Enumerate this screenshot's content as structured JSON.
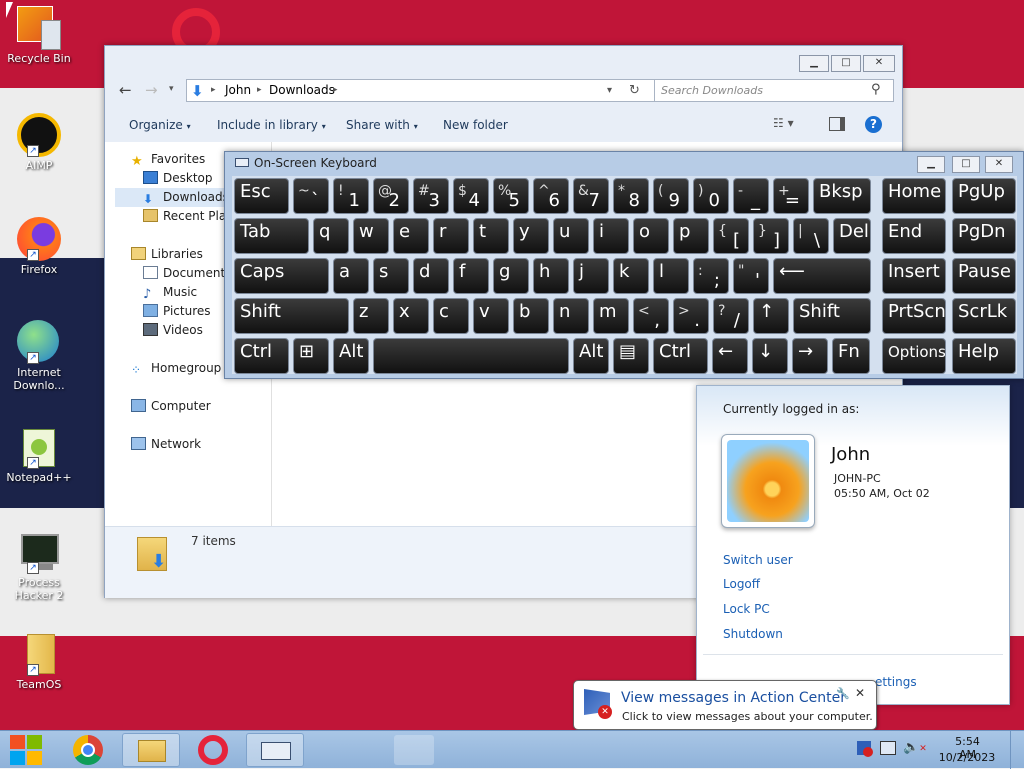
{
  "desktop": {
    "icons": [
      {
        "label": "Recycle Bin"
      },
      {
        "label": "AIMP"
      },
      {
        "label": "Firefox"
      },
      {
        "label": "Internet Downlo..."
      },
      {
        "label": "Notepad++"
      },
      {
        "label": "Process Hacker 2"
      },
      {
        "label": "TeamOS"
      }
    ]
  },
  "explorer": {
    "breadcrumb": [
      "John",
      "Downloads"
    ],
    "search_placeholder": "Search Downloads",
    "toolbar": {
      "organize": "Organize",
      "include": "Include in library",
      "share": "Share with",
      "new_folder": "New folder"
    },
    "nav": {
      "favorites": "Favorites",
      "desktop": "Desktop",
      "downloads": "Downloads",
      "recent": "Recent Places",
      "libraries": "Libraries",
      "documents": "Documents",
      "music": "Music",
      "pictures": "Pictures",
      "videos": "Videos",
      "homegroup": "Homegroup",
      "computer": "Computer",
      "network": "Network"
    },
    "status": "7 items"
  },
  "keyboard": {
    "title": "On-Screen Keyboard",
    "rows": [
      [
        {
          "m": "Esc",
          "w": 55
        },
        {
          "s": "~",
          "m": "`",
          "w": 36
        },
        {
          "s": "!",
          "m": "1",
          "w": 36
        },
        {
          "s": "@",
          "m": "2",
          "w": 36
        },
        {
          "s": "#",
          "m": "3",
          "w": 36
        },
        {
          "s": "$",
          "m": "4",
          "w": 36
        },
        {
          "s": "%",
          "m": "5",
          "w": 36
        },
        {
          "s": "^",
          "m": "6",
          "w": 36
        },
        {
          "s": "&",
          "m": "7",
          "w": 36
        },
        {
          "s": "*",
          "m": "8",
          "w": 36
        },
        {
          "s": "(",
          "m": "9",
          "w": 36
        },
        {
          "s": ")",
          "m": "0",
          "w": 36
        },
        {
          "s": "-",
          "m": "_",
          "w": 36
        },
        {
          "s": "+",
          "m": "=",
          "w": 36
        },
        {
          "m": "Bksp",
          "w": 58
        }
      ],
      [
        {
          "m": "Tab",
          "w": 75
        },
        {
          "m": "q",
          "w": 36
        },
        {
          "m": "w",
          "w": 36
        },
        {
          "m": "e",
          "w": 36
        },
        {
          "m": "r",
          "w": 36
        },
        {
          "m": "t",
          "w": 36
        },
        {
          "m": "y",
          "w": 36
        },
        {
          "m": "u",
          "w": 36
        },
        {
          "m": "i",
          "w": 36
        },
        {
          "m": "o",
          "w": 36
        },
        {
          "m": "p",
          "w": 36
        },
        {
          "s": "{",
          "m": "[",
          "w": 36
        },
        {
          "s": "}",
          "m": "]",
          "w": 36
        },
        {
          "s": "|",
          "m": "\\",
          "w": 36
        },
        {
          "m": "Del",
          "w": 38
        }
      ],
      [
        {
          "m": "Caps",
          "w": 95
        },
        {
          "m": "a",
          "w": 36
        },
        {
          "m": "s",
          "w": 36
        },
        {
          "m": "d",
          "w": 36
        },
        {
          "m": "f",
          "w": 36
        },
        {
          "m": "g",
          "w": 36
        },
        {
          "m": "h",
          "w": 36
        },
        {
          "m": "j",
          "w": 36
        },
        {
          "m": "k",
          "w": 36
        },
        {
          "m": "l",
          "w": 36
        },
        {
          "s": ":",
          "m": ";",
          "w": 36
        },
        {
          "s": "\"",
          "m": "'",
          "w": 36
        },
        {
          "m": "⟵",
          "w": 98
        }
      ],
      [
        {
          "m": "Shift",
          "w": 115
        },
        {
          "m": "z",
          "w": 36
        },
        {
          "m": "x",
          "w": 36
        },
        {
          "m": "c",
          "w": 36
        },
        {
          "m": "v",
          "w": 36
        },
        {
          "m": "b",
          "w": 36
        },
        {
          "m": "n",
          "w": 36
        },
        {
          "m": "m",
          "w": 36
        },
        {
          "s": "<",
          "m": ",",
          "w": 36
        },
        {
          "s": ">",
          "m": ".",
          "w": 36
        },
        {
          "s": "?",
          "m": "/",
          "w": 36
        },
        {
          "m": "↑",
          "w": 36
        },
        {
          "m": "Shift",
          "w": 78
        }
      ],
      [
        {
          "m": "Ctrl",
          "w": 55
        },
        {
          "m": "⊞",
          "w": 36
        },
        {
          "m": "Alt",
          "w": 36
        },
        {
          "m": "",
          "w": 196
        },
        {
          "m": "Alt",
          "w": 36
        },
        {
          "m": "▤",
          "w": 36
        },
        {
          "m": "Ctrl",
          "w": 55
        },
        {
          "m": "←",
          "w": 36
        },
        {
          "m": "↓",
          "w": 36
        },
        {
          "m": "→",
          "w": 36
        },
        {
          "m": "Fn",
          "w": 38
        }
      ]
    ],
    "right_rows": [
      [
        {
          "m": "Home"
        },
        {
          "m": "PgUp"
        }
      ],
      [
        {
          "m": "End"
        },
        {
          "m": "PgDn"
        }
      ],
      [
        {
          "m": "Insert"
        },
        {
          "m": "Pause"
        }
      ],
      [
        {
          "m": "PrtScn"
        },
        {
          "m": "ScrLk"
        }
      ],
      [
        {
          "m": "Options"
        },
        {
          "m": "Help"
        }
      ]
    ]
  },
  "user_panel": {
    "heading": "Currently logged in as:",
    "name": "John",
    "pc": "JOHN-PC",
    "time": "05:50 AM, Oct 02",
    "links": [
      "Switch user",
      "Logoff",
      "Lock PC",
      "Shutdown"
    ],
    "footer": "ettings"
  },
  "tooltip": {
    "title": "View messages in Action Center",
    "body": "Click to view messages about your computer."
  },
  "taskbar": {
    "time": "5:54 AM",
    "date": "10/2/2023"
  },
  "colors": {
    "accent": "#c01538",
    "dark_band": "#1b2349",
    "link": "#1a5fb4"
  }
}
